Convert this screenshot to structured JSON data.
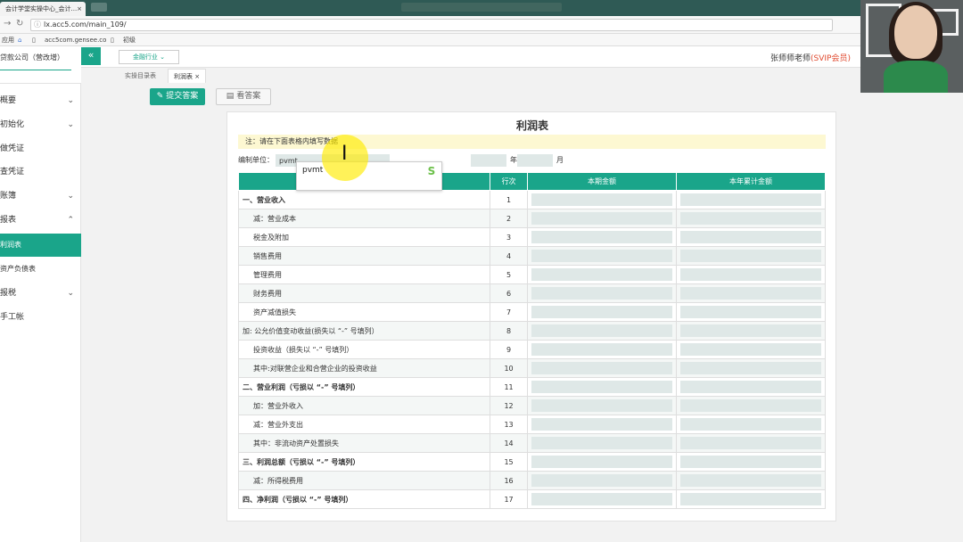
{
  "browser": {
    "tab_title": "会计学堂实操中心_会计...",
    "tab_close": "×",
    "url": "lx.acc5.com/main_109/",
    "bookmarks": [
      "应用",
      "acc5com.gensee.co",
      "初级"
    ]
  },
  "app": {
    "company": "贷款公司（营改增）",
    "collapse_glyph": "«",
    "industry": "金融行业",
    "teacher": "张师师老师",
    "member": "(SVIP会员)",
    "accent": "#1aa58a"
  },
  "sidebar": {
    "items": [
      {
        "label": "概要",
        "chev": "⌄"
      },
      {
        "label": "初始化",
        "chev": "⌄"
      },
      {
        "label": "做凭证",
        "chev": ""
      },
      {
        "label": "查凭证",
        "chev": ""
      },
      {
        "label": "账簿",
        "chev": "⌄"
      },
      {
        "label": "报表",
        "chev": "⌃"
      },
      {
        "label": "利润表",
        "chev": ""
      },
      {
        "label": "资产负债表",
        "chev": ""
      },
      {
        "label": "报税",
        "chev": "⌄"
      },
      {
        "label": "手工帐",
        "chev": ""
      }
    ]
  },
  "page_tabs": {
    "items": [
      "实操目录表",
      "利润表"
    ],
    "close": "×"
  },
  "actions": {
    "submit": "提交答案",
    "view_answer": "看答案"
  },
  "report": {
    "title": "利润表",
    "note": "注：请在下面表格内填写数据",
    "unit_label": "编制单位：",
    "unit_value": "pvmt",
    "year_label": "年",
    "month_label": "月",
    "headers": [
      "行次",
      "本期金额",
      "本年累计金额"
    ],
    "rows": [
      {
        "item": "一、营业收入",
        "line": "1",
        "style": "bold"
      },
      {
        "item": "减：营业成本",
        "line": "2",
        "style": "ind"
      },
      {
        "item": "税金及附加",
        "line": "3",
        "style": "ind"
      },
      {
        "item": "销售费用",
        "line": "4",
        "style": "ind"
      },
      {
        "item": "管理费用",
        "line": "5",
        "style": "ind"
      },
      {
        "item": "财务费用",
        "line": "6",
        "style": "ind"
      },
      {
        "item": "资产减值损失",
        "line": "7",
        "style": "ind"
      },
      {
        "item": "加: 公允价值变动收益(损失以 “-” 号填列）",
        "line": "8",
        "style": ""
      },
      {
        "item": "投资收益（损失以 “-” 号填列）",
        "line": "9",
        "style": "ind"
      },
      {
        "item": "其中:对联营企业和合营企业的投资收益",
        "line": "10",
        "style": "ind"
      },
      {
        "item": "二、营业利润（亏损以 “-” 号填列）",
        "line": "11",
        "style": "bold"
      },
      {
        "item": "加：营业外收入",
        "line": "12",
        "style": "ind"
      },
      {
        "item": "减：营业外支出",
        "line": "13",
        "style": "ind"
      },
      {
        "item": "其中：非流动资产处置损失",
        "line": "14",
        "style": "ind"
      },
      {
        "item": "三、利润总额（亏损以 “-” 号填列）",
        "line": "15",
        "style": "bold"
      },
      {
        "item": "减：所得税费用",
        "line": "16",
        "style": "ind"
      },
      {
        "item": "四、净利润（亏损以 “-” 号填列）",
        "line": "17",
        "style": "bold"
      }
    ]
  },
  "autocomplete": {
    "text": "pvmt",
    "ime_logo": "S"
  }
}
